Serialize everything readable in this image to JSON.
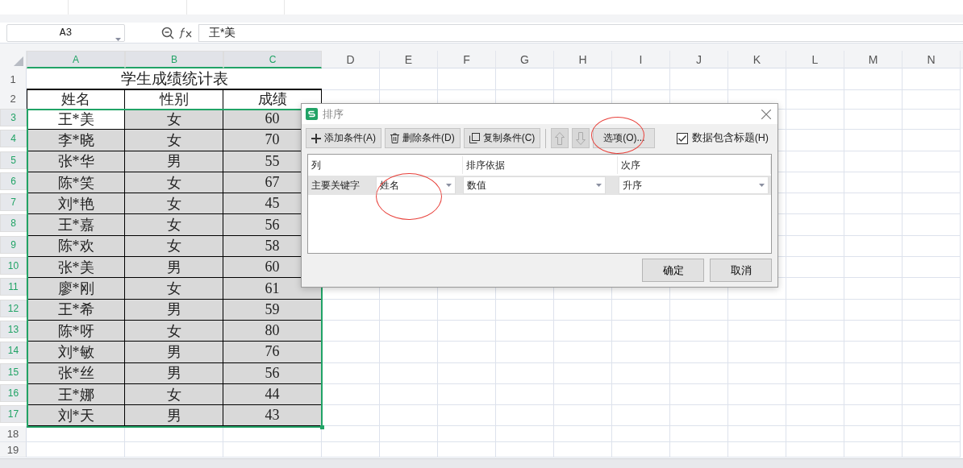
{
  "name_box": {
    "value": "A3"
  },
  "formula_bar": {
    "value": "王*美"
  },
  "columns": [
    {
      "label": "A",
      "selected": true
    },
    {
      "label": "B",
      "selected": true
    },
    {
      "label": "C",
      "selected": true
    },
    {
      "label": "D",
      "selected": false
    },
    {
      "label": "E",
      "selected": false
    },
    {
      "label": "F",
      "selected": false
    },
    {
      "label": "G",
      "selected": false
    },
    {
      "label": "H",
      "selected": false
    },
    {
      "label": "I",
      "selected": false
    },
    {
      "label": "J",
      "selected": false
    },
    {
      "label": "K",
      "selected": false
    },
    {
      "label": "L",
      "selected": false
    },
    {
      "label": "M",
      "selected": false
    },
    {
      "label": "N",
      "selected": false
    }
  ],
  "sheet": {
    "title": "学生成绩统计表",
    "title_row": "1",
    "header_row": "2",
    "headers": [
      "姓名",
      "性别",
      "成绩"
    ],
    "records": [
      {
        "row": "3",
        "name": "王*美",
        "gender": "女",
        "score": "60",
        "selected": true,
        "active": true
      },
      {
        "row": "4",
        "name": "李*晓",
        "gender": "女",
        "score": "70",
        "selected": true,
        "active": false
      },
      {
        "row": "5",
        "name": "张*华",
        "gender": "男",
        "score": "55",
        "selected": true,
        "active": false
      },
      {
        "row": "6",
        "name": "陈*笑",
        "gender": "女",
        "score": "67",
        "selected": true,
        "active": false
      },
      {
        "row": "7",
        "name": "刘*艳",
        "gender": "女",
        "score": "45",
        "selected": true,
        "active": false
      },
      {
        "row": "8",
        "name": "王*嘉",
        "gender": "女",
        "score": "56",
        "selected": true,
        "active": false
      },
      {
        "row": "9",
        "name": "陈*欢",
        "gender": "女",
        "score": "58",
        "selected": true,
        "active": false
      },
      {
        "row": "10",
        "name": "张*美",
        "gender": "男",
        "score": "60",
        "selected": true,
        "active": false
      },
      {
        "row": "11",
        "name": "廖*刚",
        "gender": "女",
        "score": "61",
        "selected": true,
        "active": false
      },
      {
        "row": "12",
        "name": "王*希",
        "gender": "男",
        "score": "59",
        "selected": true,
        "active": false
      },
      {
        "row": "13",
        "name": "陈*呀",
        "gender": "女",
        "score": "80",
        "selected": true,
        "active": false
      },
      {
        "row": "14",
        "name": "刘*敏",
        "gender": "男",
        "score": "76",
        "selected": true,
        "active": false
      },
      {
        "row": "15",
        "name": "张*丝",
        "gender": "男",
        "score": "56",
        "selected": true,
        "active": false
      },
      {
        "row": "16",
        "name": "王*娜",
        "gender": "女",
        "score": "44",
        "selected": true,
        "active": false
      },
      {
        "row": "17",
        "name": "刘*天",
        "gender": "男",
        "score": "43",
        "selected": true,
        "active": false
      }
    ],
    "empty_rows": [
      "18",
      "19"
    ]
  },
  "dialog": {
    "title": "排序",
    "toolbar": [
      {
        "kind": "add",
        "label": "添加条件(A)",
        "disabled": false,
        "highlighted": false
      },
      {
        "kind": "delete",
        "label": "删除条件(D)",
        "disabled": false,
        "highlighted": false
      },
      {
        "kind": "copy",
        "label": "复制条件(C)",
        "disabled": false,
        "highlighted": false
      },
      {
        "kind": "up",
        "disabled": true,
        "highlighted": false
      },
      {
        "kind": "down",
        "disabled": true,
        "highlighted": false
      },
      {
        "kind": "options",
        "label": "选项(O)...",
        "disabled": false,
        "highlighted": true
      }
    ],
    "header_checkbox": {
      "label": "数据包含标题(H)",
      "checked": true
    },
    "list_headers": [
      "列",
      "排序依据",
      "次序"
    ],
    "conditions": [
      {
        "label": "主要关键字",
        "column": {
          "value": "姓名",
          "highlighted": true
        },
        "basis": "数值",
        "order": "升序"
      }
    ],
    "buttons": [
      "确定",
      "取消"
    ]
  }
}
